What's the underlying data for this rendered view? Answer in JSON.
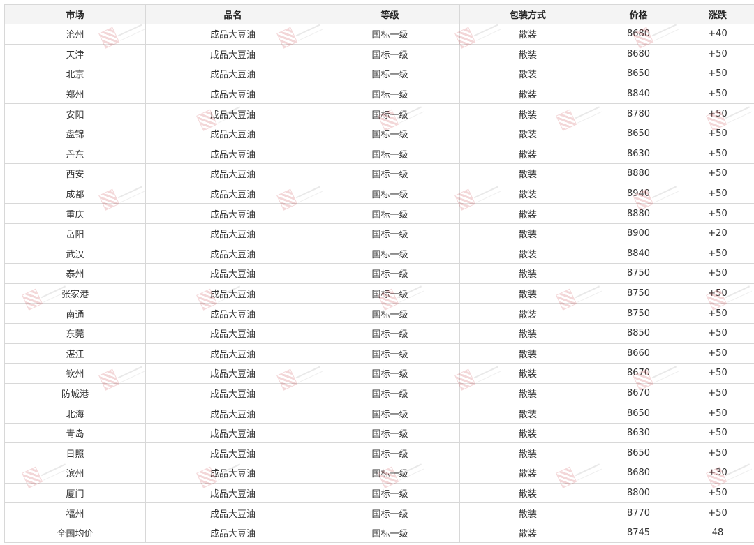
{
  "table": {
    "headers": {
      "market": "市场",
      "product": "品名",
      "grade": "等级",
      "packaging": "包装方式",
      "price": "价格",
      "change": "涨跌"
    },
    "rows": [
      {
        "market": "沧州",
        "product": "成品大豆油",
        "grade": "国标一级",
        "packaging": "散装",
        "price": "8680",
        "change": "+40"
      },
      {
        "market": "天津",
        "product": "成品大豆油",
        "grade": "国标一级",
        "packaging": "散装",
        "price": "8680",
        "change": "+50"
      },
      {
        "market": "北京",
        "product": "成品大豆油",
        "grade": "国标一级",
        "packaging": "散装",
        "price": "8650",
        "change": "+50"
      },
      {
        "market": "郑州",
        "product": "成品大豆油",
        "grade": "国标一级",
        "packaging": "散装",
        "price": "8840",
        "change": "+50"
      },
      {
        "market": "安阳",
        "product": "成品大豆油",
        "grade": "国标一级",
        "packaging": "散装",
        "price": "8780",
        "change": "+50"
      },
      {
        "market": "盘锦",
        "product": "成品大豆油",
        "grade": "国标一级",
        "packaging": "散装",
        "price": "8650",
        "change": "+50"
      },
      {
        "market": "丹东",
        "product": "成品大豆油",
        "grade": "国标一级",
        "packaging": "散装",
        "price": "8630",
        "change": "+50"
      },
      {
        "market": "西安",
        "product": "成品大豆油",
        "grade": "国标一级",
        "packaging": "散装",
        "price": "8880",
        "change": "+50"
      },
      {
        "market": "成都",
        "product": "成品大豆油",
        "grade": "国标一级",
        "packaging": "散装",
        "price": "8940",
        "change": "+50"
      },
      {
        "market": "重庆",
        "product": "成品大豆油",
        "grade": "国标一级",
        "packaging": "散装",
        "price": "8880",
        "change": "+50"
      },
      {
        "market": "岳阳",
        "product": "成品大豆油",
        "grade": "国标一级",
        "packaging": "散装",
        "price": "8900",
        "change": "+20"
      },
      {
        "market": "武汉",
        "product": "成品大豆油",
        "grade": "国标一级",
        "packaging": "散装",
        "price": "8840",
        "change": "+50"
      },
      {
        "market": "泰州",
        "product": "成品大豆油",
        "grade": "国标一级",
        "packaging": "散装",
        "price": "8750",
        "change": "+50"
      },
      {
        "market": "张家港",
        "product": "成品大豆油",
        "grade": "国标一级",
        "packaging": "散装",
        "price": "8750",
        "change": "+50"
      },
      {
        "market": "南通",
        "product": "成品大豆油",
        "grade": "国标一级",
        "packaging": "散装",
        "price": "8750",
        "change": "+50"
      },
      {
        "market": "东莞",
        "product": "成品大豆油",
        "grade": "国标一级",
        "packaging": "散装",
        "price": "8850",
        "change": "+50"
      },
      {
        "market": "湛江",
        "product": "成品大豆油",
        "grade": "国标一级",
        "packaging": "散装",
        "price": "8660",
        "change": "+50"
      },
      {
        "market": "钦州",
        "product": "成品大豆油",
        "grade": "国标一级",
        "packaging": "散装",
        "price": "8670",
        "change": "+50"
      },
      {
        "market": "防城港",
        "product": "成品大豆油",
        "grade": "国标一级",
        "packaging": "散装",
        "price": "8670",
        "change": "+50"
      },
      {
        "market": "北海",
        "product": "成品大豆油",
        "grade": "国标一级",
        "packaging": "散装",
        "price": "8650",
        "change": "+50"
      },
      {
        "market": "青岛",
        "product": "成品大豆油",
        "grade": "国标一级",
        "packaging": "散装",
        "price": "8630",
        "change": "+50"
      },
      {
        "market": "日照",
        "product": "成品大豆油",
        "grade": "国标一级",
        "packaging": "散装",
        "price": "8650",
        "change": "+50"
      },
      {
        "market": "滨州",
        "product": "成品大豆油",
        "grade": "国标一级",
        "packaging": "散装",
        "price": "8680",
        "change": "+30"
      },
      {
        "market": "厦门",
        "product": "成品大豆油",
        "grade": "国标一级",
        "packaging": "散装",
        "price": "8800",
        "change": "+50"
      },
      {
        "market": "福州",
        "product": "成品大豆油",
        "grade": "国标一级",
        "packaging": "散装",
        "price": "8770",
        "change": "+50"
      },
      {
        "market": "全国均价",
        "product": "成品大豆油",
        "grade": "国标一级",
        "packaging": "散装",
        "price": "8745",
        "change": "48"
      }
    ]
  },
  "watermark": {
    "logo": "Mysteel.com",
    "color": "#c2262e"
  }
}
